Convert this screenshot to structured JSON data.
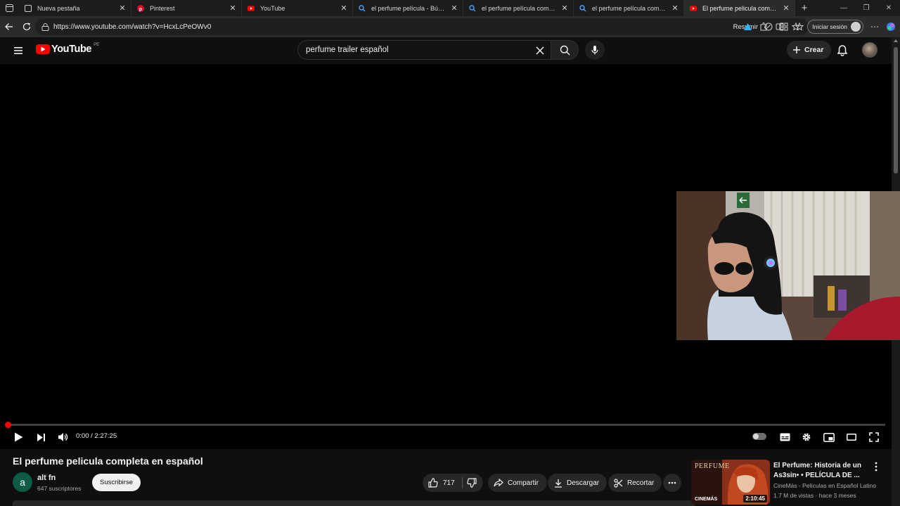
{
  "browser": {
    "tabs": [
      {
        "title": "Nueva pestaña",
        "favicon": "new-tab-icon"
      },
      {
        "title": "Pinterest",
        "favicon": "pinterest-icon"
      },
      {
        "title": "YouTube",
        "favicon": "youtube-icon"
      },
      {
        "title": "el perfume película - Búsqueda",
        "favicon": "search-icon"
      },
      {
        "title": "el perfume película completa - B",
        "favicon": "search-icon"
      },
      {
        "title": "el perfume película completa - B",
        "favicon": "search-icon"
      },
      {
        "title": "El perfume pelicula completa en",
        "favicon": "youtube-icon",
        "active": true
      }
    ],
    "url": "https://www.youtube.com/watch?v=HcxLcPeOWv0",
    "resumir_label": "Resumir",
    "signin_label": "Iniciar sesión"
  },
  "youtube": {
    "logo_text": "YouTube",
    "country_code": "PE",
    "search_value": "perfume trailer español",
    "create_label": "Crear"
  },
  "player": {
    "timecode": "0:00 / 2:27:25",
    "progress": 0.0,
    "accent": "#ff0000"
  },
  "video": {
    "title": "El perfume pelicula completa en español",
    "channel_initial": "a",
    "channel_name": "alt fn",
    "subscribers": "647 suscriptores",
    "subscribe_label": "Suscribirse",
    "likes": "717",
    "share_label": "Compartir",
    "download_label": "Descargar",
    "clip_label": "Recortar"
  },
  "recommendation": {
    "title": "El Perfume: Historia de un As3sin• • PELÍCULA DE ...",
    "channel": "CineMás - Películas en Español Latino",
    "meta": "1.7 M de vistas · hace 3 meses",
    "duration": "2:10:45",
    "thumb_title": "PERFUME",
    "thumb_brand": "CINEMÁS"
  }
}
